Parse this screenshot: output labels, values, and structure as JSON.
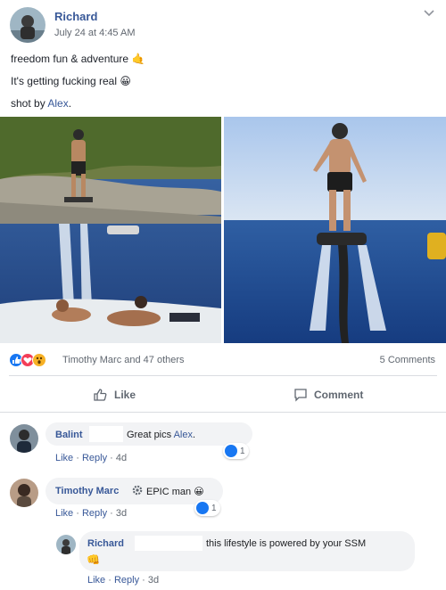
{
  "post": {
    "author": "Richard",
    "timestamp": "July 24 at 4:45 AM",
    "line1": "freedom fun & adventure",
    "line1_emoji": "🤙",
    "line2": "It's getting fucking real",
    "line2_emoji": "😀",
    "line3_prefix": "shot by",
    "line3_tag": "Alex",
    "line3_suffix": "."
  },
  "reactions": {
    "icons": [
      "like-icon",
      "love-icon",
      "wow-icon"
    ],
    "text": "Timothy Marc and 47 others",
    "comments_count": "5 Comments"
  },
  "actions": {
    "like_label": "Like",
    "comment_label": "Comment"
  },
  "comments": [
    {
      "name": "Balint",
      "text": "Great pics",
      "tag": "Alex",
      "tag_suffix": ".",
      "like": "Like",
      "reply": "Reply",
      "time": "4d",
      "reaction_count": "1"
    },
    {
      "name": "Timothy Marc",
      "text": "EPIC man",
      "emoji": "😀",
      "like": "Like",
      "reply": "Reply",
      "time": "3d",
      "reaction_count": "1"
    },
    {
      "name": "Richard",
      "text": "this lifestyle is powered by your SSM",
      "emoji": "👊",
      "like": "Like",
      "reply": "Reply",
      "time": "3d"
    }
  ],
  "colors": {
    "link": "#385898",
    "like_blue": "#1877f2",
    "love_red": "#f33e58",
    "wow_yellow": "#f7b125",
    "bubble": "#f2f3f5"
  }
}
